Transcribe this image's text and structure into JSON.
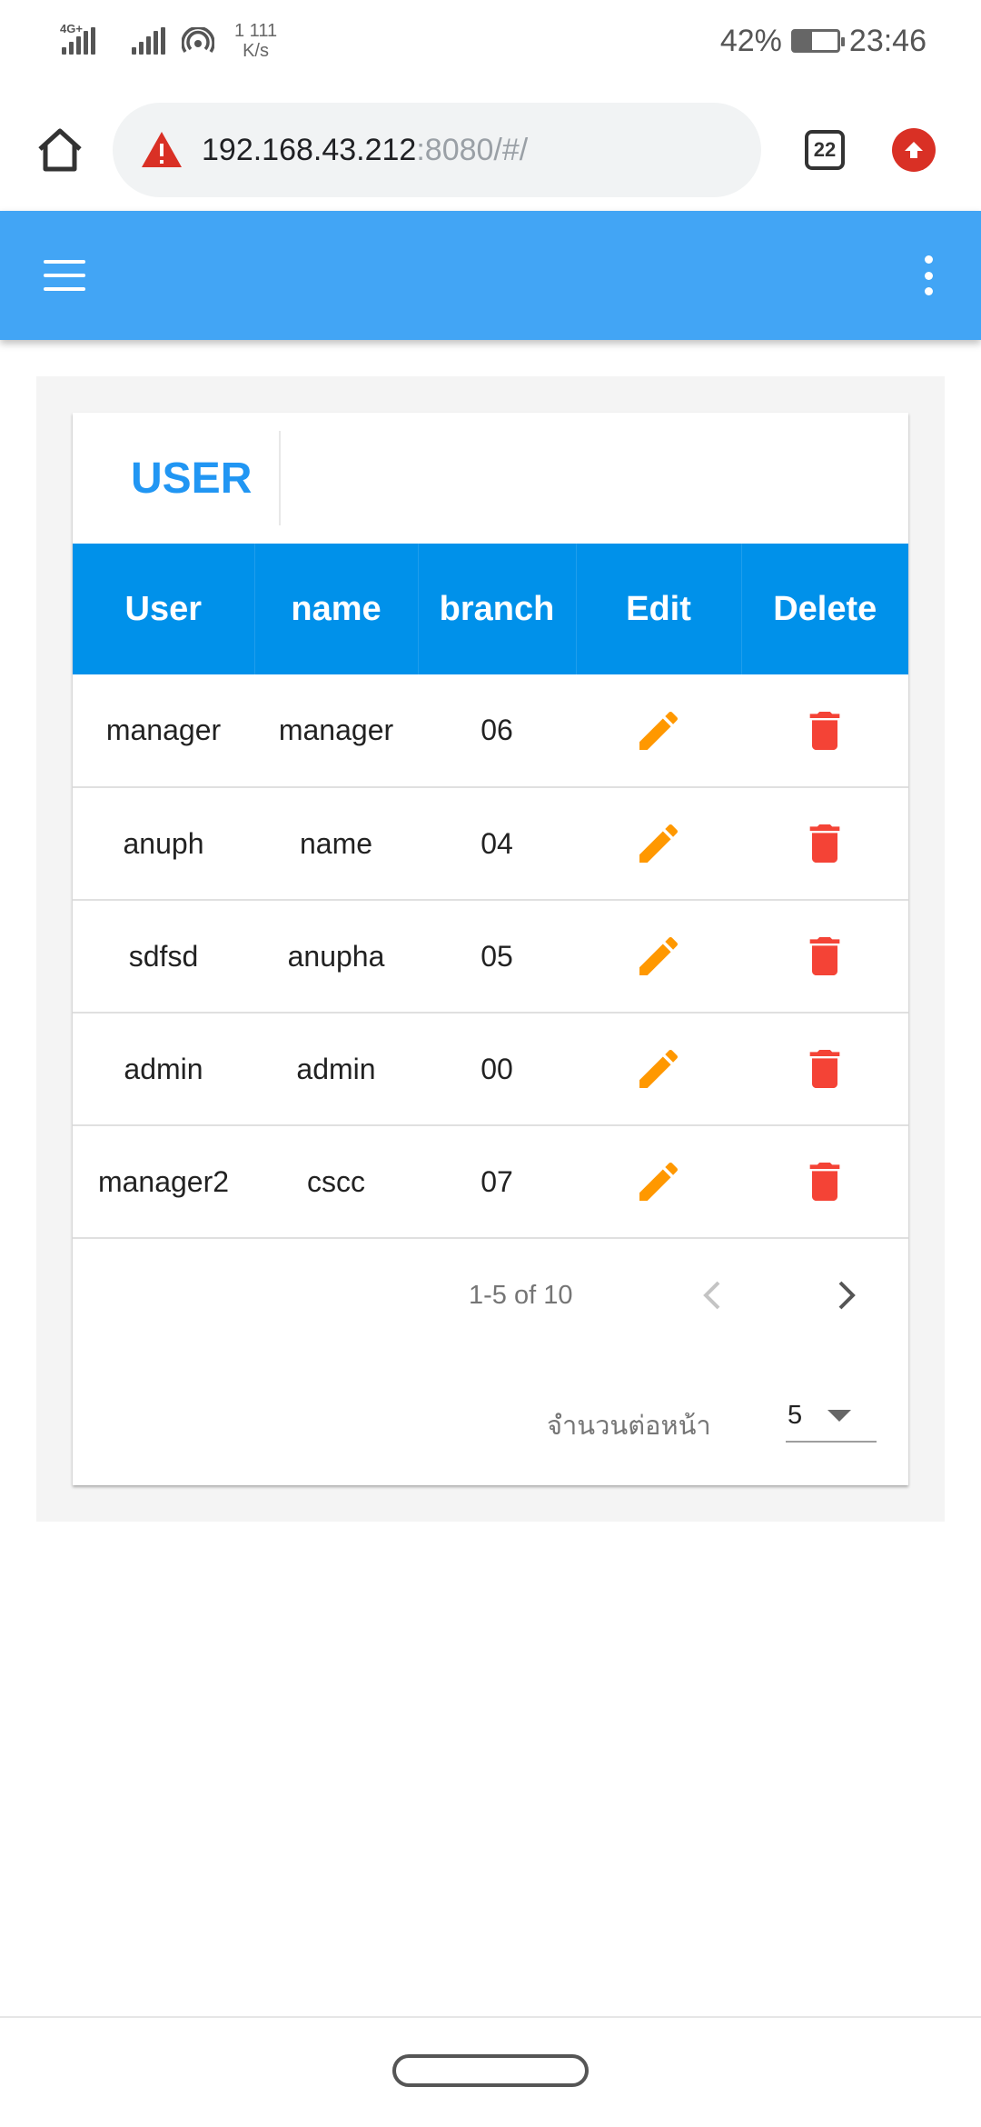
{
  "status_bar": {
    "network_type": "4G+",
    "speed_value": "1 111",
    "speed_unit": "K/s",
    "battery": "42%",
    "time": "23:46"
  },
  "browser": {
    "url_host": "192.168.43.212",
    "url_rest": ":8080/#/",
    "tab_count": "22",
    "warning_icon": "warning-triangle-icon",
    "upload_icon": "upload-arrow-icon"
  },
  "app_bar": {
    "color": "#42a5f5"
  },
  "card": {
    "title": "USER",
    "title_color": "#2196f3",
    "header_color": "#0091ea",
    "columns": [
      "User",
      "name",
      "branch",
      "Edit",
      "Delete"
    ],
    "rows": [
      {
        "user": "manager",
        "name": "manager",
        "branch": "06"
      },
      {
        "user": "anuph",
        "name": "name",
        "branch": "04"
      },
      {
        "user": "sdfsd",
        "name": "anupha",
        "branch": "05"
      },
      {
        "user": "admin",
        "name": "admin",
        "branch": "00"
      },
      {
        "user": "manager2",
        "name": "cscc",
        "branch": "07"
      }
    ],
    "edit_icon_color": "#ff9800",
    "delete_icon_color": "#f44336"
  },
  "pagination": {
    "range_text": "1-5 of 10",
    "per_page_label": "จำนวนต่อหน้า",
    "per_page_value": "5"
  }
}
